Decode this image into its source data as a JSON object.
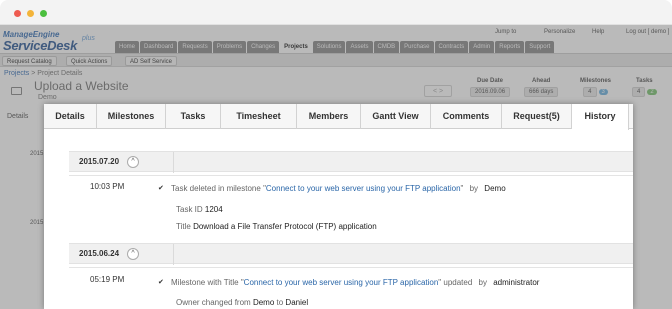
{
  "window": {
    "buttons": [
      "close",
      "minimize",
      "maximize"
    ]
  },
  "app": {
    "logo_top": "ManageEngine",
    "logo_main": "ServiceDesk",
    "logo_plus": "plus",
    "toplinks": {
      "jump_to": "Jump to",
      "personalize": "Personalize",
      "help": "Help",
      "logout": "Log out [ demo ]"
    },
    "nav": [
      "Home",
      "Dashboard",
      "Requests",
      "Problems",
      "Changes",
      "Projects",
      "Solutions",
      "Assets",
      "CMDB",
      "Purchase",
      "Contracts",
      "Admin",
      "Reports",
      "Support"
    ],
    "nav_active": "Projects",
    "subbar": {
      "request_catalog": "Request Catalog",
      "quick_actions": "Quick Actions",
      "self_service": "AD Self Service"
    },
    "breadcrumb": {
      "link": "Projects",
      "current": "Project Details"
    },
    "project": {
      "title": "Upload a Website",
      "owner": "Demo"
    },
    "stats": [
      {
        "label": "Due Date",
        "value": "2016.09.06"
      },
      {
        "label": "Ahead",
        "value": "666 days"
      },
      {
        "label": "Milestones",
        "value": "4",
        "badge": "3"
      },
      {
        "label": "Tasks",
        "value": "4",
        "badge": "2"
      }
    ],
    "details_tab": "Details",
    "left_years": [
      "2015",
      "2015"
    ]
  },
  "modal": {
    "tabs": [
      "Details",
      "Milestones",
      "Tasks",
      "Timesheet",
      "Members",
      "Gantt View",
      "Comments",
      "Request(5)",
      "History"
    ],
    "active_tab": "History",
    "groups": [
      {
        "date": "2015.07.20",
        "time": "10:03 PM",
        "entry": {
          "prefix": "Task deleted in milestone",
          "quote_open": "\"",
          "milestone": "Connect to your web server using your FTP application",
          "quote_close": "\"",
          "by": "by",
          "user": "Demo",
          "task_id_label": "Task ID",
          "task_id": "1204",
          "title_label": "Title",
          "title": "Download a File Transfer Protocol (FTP) application"
        }
      },
      {
        "date": "2015.06.24",
        "time": "05:19 PM",
        "entry": {
          "prefix": "Milestone with Title",
          "quote_open": "\"",
          "milestone": "Connect to your web server using your FTP application",
          "quote_close": "\"",
          "action": "updated",
          "by": "by",
          "user": "administrator",
          "owner_label": "Owner changed from",
          "from": "Demo",
          "to_label": "to",
          "to": "Daniel"
        }
      }
    ]
  }
}
